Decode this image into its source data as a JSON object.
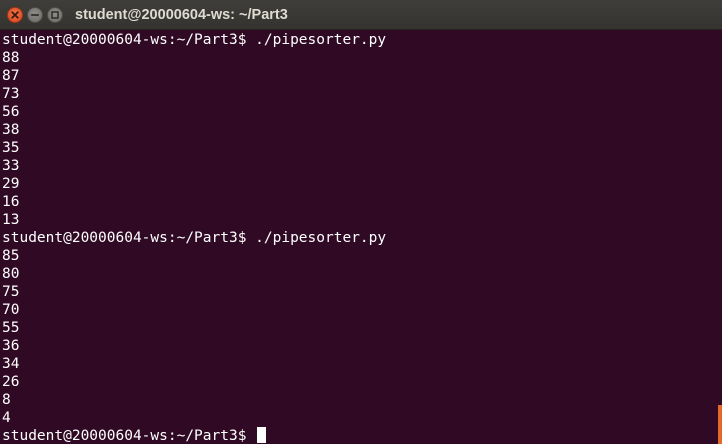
{
  "window": {
    "title": "student@20000604-ws: ~/Part3",
    "buttons": {
      "close_icon": "close-icon",
      "minimize_icon": "minimize-icon",
      "maximize_icon": "maximize-icon"
    },
    "colors": {
      "terminal_bg": "#300a24",
      "text": "#ffffff",
      "close_button": "#e95420"
    }
  },
  "terminal": {
    "lines": [
      "student@20000604-ws:~/Part3$ ./pipesorter.py",
      "88",
      "87",
      "73",
      "56",
      "38",
      "35",
      "33",
      "29",
      "16",
      "13",
      "student@20000604-ws:~/Part3$ ./pipesorter.py",
      "85",
      "80",
      "75",
      "70",
      "55",
      "36",
      "34",
      "26",
      "8",
      "4"
    ],
    "prompt": "student@20000604-ws:~/Part3$ "
  }
}
